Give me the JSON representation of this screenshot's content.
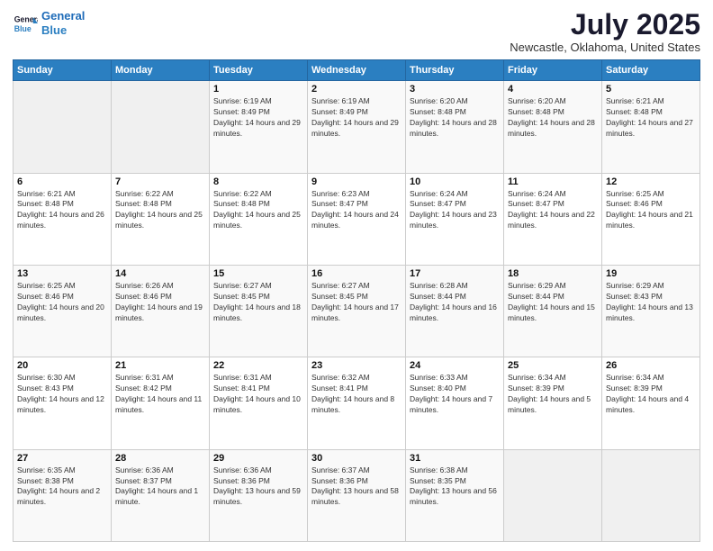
{
  "header": {
    "logo_line1": "General",
    "logo_line2": "Blue",
    "month": "July 2025",
    "location": "Newcastle, Oklahoma, United States"
  },
  "weekdays": [
    "Sunday",
    "Monday",
    "Tuesday",
    "Wednesday",
    "Thursday",
    "Friday",
    "Saturday"
  ],
  "weeks": [
    [
      {
        "day": "",
        "empty": true
      },
      {
        "day": "",
        "empty": true
      },
      {
        "day": "1",
        "sunrise": "Sunrise: 6:19 AM",
        "sunset": "Sunset: 8:49 PM",
        "daylight": "Daylight: 14 hours and 29 minutes."
      },
      {
        "day": "2",
        "sunrise": "Sunrise: 6:19 AM",
        "sunset": "Sunset: 8:49 PM",
        "daylight": "Daylight: 14 hours and 29 minutes."
      },
      {
        "day": "3",
        "sunrise": "Sunrise: 6:20 AM",
        "sunset": "Sunset: 8:48 PM",
        "daylight": "Daylight: 14 hours and 28 minutes."
      },
      {
        "day": "4",
        "sunrise": "Sunrise: 6:20 AM",
        "sunset": "Sunset: 8:48 PM",
        "daylight": "Daylight: 14 hours and 28 minutes."
      },
      {
        "day": "5",
        "sunrise": "Sunrise: 6:21 AM",
        "sunset": "Sunset: 8:48 PM",
        "daylight": "Daylight: 14 hours and 27 minutes."
      }
    ],
    [
      {
        "day": "6",
        "sunrise": "Sunrise: 6:21 AM",
        "sunset": "Sunset: 8:48 PM",
        "daylight": "Daylight: 14 hours and 26 minutes."
      },
      {
        "day": "7",
        "sunrise": "Sunrise: 6:22 AM",
        "sunset": "Sunset: 8:48 PM",
        "daylight": "Daylight: 14 hours and 25 minutes."
      },
      {
        "day": "8",
        "sunrise": "Sunrise: 6:22 AM",
        "sunset": "Sunset: 8:48 PM",
        "daylight": "Daylight: 14 hours and 25 minutes."
      },
      {
        "day": "9",
        "sunrise": "Sunrise: 6:23 AM",
        "sunset": "Sunset: 8:47 PM",
        "daylight": "Daylight: 14 hours and 24 minutes."
      },
      {
        "day": "10",
        "sunrise": "Sunrise: 6:24 AM",
        "sunset": "Sunset: 8:47 PM",
        "daylight": "Daylight: 14 hours and 23 minutes."
      },
      {
        "day": "11",
        "sunrise": "Sunrise: 6:24 AM",
        "sunset": "Sunset: 8:47 PM",
        "daylight": "Daylight: 14 hours and 22 minutes."
      },
      {
        "day": "12",
        "sunrise": "Sunrise: 6:25 AM",
        "sunset": "Sunset: 8:46 PM",
        "daylight": "Daylight: 14 hours and 21 minutes."
      }
    ],
    [
      {
        "day": "13",
        "sunrise": "Sunrise: 6:25 AM",
        "sunset": "Sunset: 8:46 PM",
        "daylight": "Daylight: 14 hours and 20 minutes."
      },
      {
        "day": "14",
        "sunrise": "Sunrise: 6:26 AM",
        "sunset": "Sunset: 8:46 PM",
        "daylight": "Daylight: 14 hours and 19 minutes."
      },
      {
        "day": "15",
        "sunrise": "Sunrise: 6:27 AM",
        "sunset": "Sunset: 8:45 PM",
        "daylight": "Daylight: 14 hours and 18 minutes."
      },
      {
        "day": "16",
        "sunrise": "Sunrise: 6:27 AM",
        "sunset": "Sunset: 8:45 PM",
        "daylight": "Daylight: 14 hours and 17 minutes."
      },
      {
        "day": "17",
        "sunrise": "Sunrise: 6:28 AM",
        "sunset": "Sunset: 8:44 PM",
        "daylight": "Daylight: 14 hours and 16 minutes."
      },
      {
        "day": "18",
        "sunrise": "Sunrise: 6:29 AM",
        "sunset": "Sunset: 8:44 PM",
        "daylight": "Daylight: 14 hours and 15 minutes."
      },
      {
        "day": "19",
        "sunrise": "Sunrise: 6:29 AM",
        "sunset": "Sunset: 8:43 PM",
        "daylight": "Daylight: 14 hours and 13 minutes."
      }
    ],
    [
      {
        "day": "20",
        "sunrise": "Sunrise: 6:30 AM",
        "sunset": "Sunset: 8:43 PM",
        "daylight": "Daylight: 14 hours and 12 minutes."
      },
      {
        "day": "21",
        "sunrise": "Sunrise: 6:31 AM",
        "sunset": "Sunset: 8:42 PM",
        "daylight": "Daylight: 14 hours and 11 minutes."
      },
      {
        "day": "22",
        "sunrise": "Sunrise: 6:31 AM",
        "sunset": "Sunset: 8:41 PM",
        "daylight": "Daylight: 14 hours and 10 minutes."
      },
      {
        "day": "23",
        "sunrise": "Sunrise: 6:32 AM",
        "sunset": "Sunset: 8:41 PM",
        "daylight": "Daylight: 14 hours and 8 minutes."
      },
      {
        "day": "24",
        "sunrise": "Sunrise: 6:33 AM",
        "sunset": "Sunset: 8:40 PM",
        "daylight": "Daylight: 14 hours and 7 minutes."
      },
      {
        "day": "25",
        "sunrise": "Sunrise: 6:34 AM",
        "sunset": "Sunset: 8:39 PM",
        "daylight": "Daylight: 14 hours and 5 minutes."
      },
      {
        "day": "26",
        "sunrise": "Sunrise: 6:34 AM",
        "sunset": "Sunset: 8:39 PM",
        "daylight": "Daylight: 14 hours and 4 minutes."
      }
    ],
    [
      {
        "day": "27",
        "sunrise": "Sunrise: 6:35 AM",
        "sunset": "Sunset: 8:38 PM",
        "daylight": "Daylight: 14 hours and 2 minutes."
      },
      {
        "day": "28",
        "sunrise": "Sunrise: 6:36 AM",
        "sunset": "Sunset: 8:37 PM",
        "daylight": "Daylight: 14 hours and 1 minute."
      },
      {
        "day": "29",
        "sunrise": "Sunrise: 6:36 AM",
        "sunset": "Sunset: 8:36 PM",
        "daylight": "Daylight: 13 hours and 59 minutes."
      },
      {
        "day": "30",
        "sunrise": "Sunrise: 6:37 AM",
        "sunset": "Sunset: 8:36 PM",
        "daylight": "Daylight: 13 hours and 58 minutes."
      },
      {
        "day": "31",
        "sunrise": "Sunrise: 6:38 AM",
        "sunset": "Sunset: 8:35 PM",
        "daylight": "Daylight: 13 hours and 56 minutes."
      },
      {
        "day": "",
        "empty": true
      },
      {
        "day": "",
        "empty": true
      }
    ]
  ]
}
